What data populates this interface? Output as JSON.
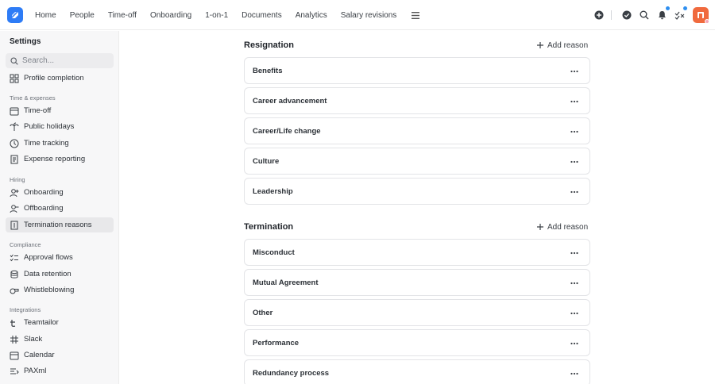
{
  "topnav": {
    "items": [
      "Home",
      "People",
      "Time-off",
      "Onboarding",
      "1-on-1",
      "Documents",
      "Analytics",
      "Salary revisions"
    ]
  },
  "sidebar": {
    "title": "Settings",
    "search_placeholder": "Search...",
    "profile_completion": "Profile completion",
    "sections": {
      "time": "Time & expenses",
      "hiring": "Hiring",
      "compliance": "Compliance",
      "integrations": "Integrations"
    },
    "items": {
      "timeoff": "Time-off",
      "holidays": "Public holidays",
      "tracking": "Time tracking",
      "expense": "Expense reporting",
      "onboarding": "Onboarding",
      "offboarding": "Offboarding",
      "termination": "Termination reasons",
      "approval": "Approval flows",
      "retention": "Data retention",
      "whistle": "Whistleblowing",
      "teamtailor": "Teamtailor",
      "slack": "Slack",
      "calendar": "Calendar",
      "paxml": "PAXml"
    }
  },
  "main": {
    "resignation": {
      "title": "Resignation",
      "add_label": "Add reason",
      "reasons": [
        "Benefits",
        "Career advancement",
        "Career/Life change",
        "Culture",
        "Leadership"
      ]
    },
    "termination": {
      "title": "Termination",
      "add_label": "Add reason",
      "reasons": [
        "Misconduct",
        "Mutual Agreement",
        "Other",
        "Performance",
        "Redundancy process"
      ]
    }
  },
  "colors": {
    "accent": "#2e7cf6",
    "avatar": "#f06a3e",
    "notification_dot": "#2e8ff0",
    "sidebar_bg": "#f7f7f8"
  }
}
